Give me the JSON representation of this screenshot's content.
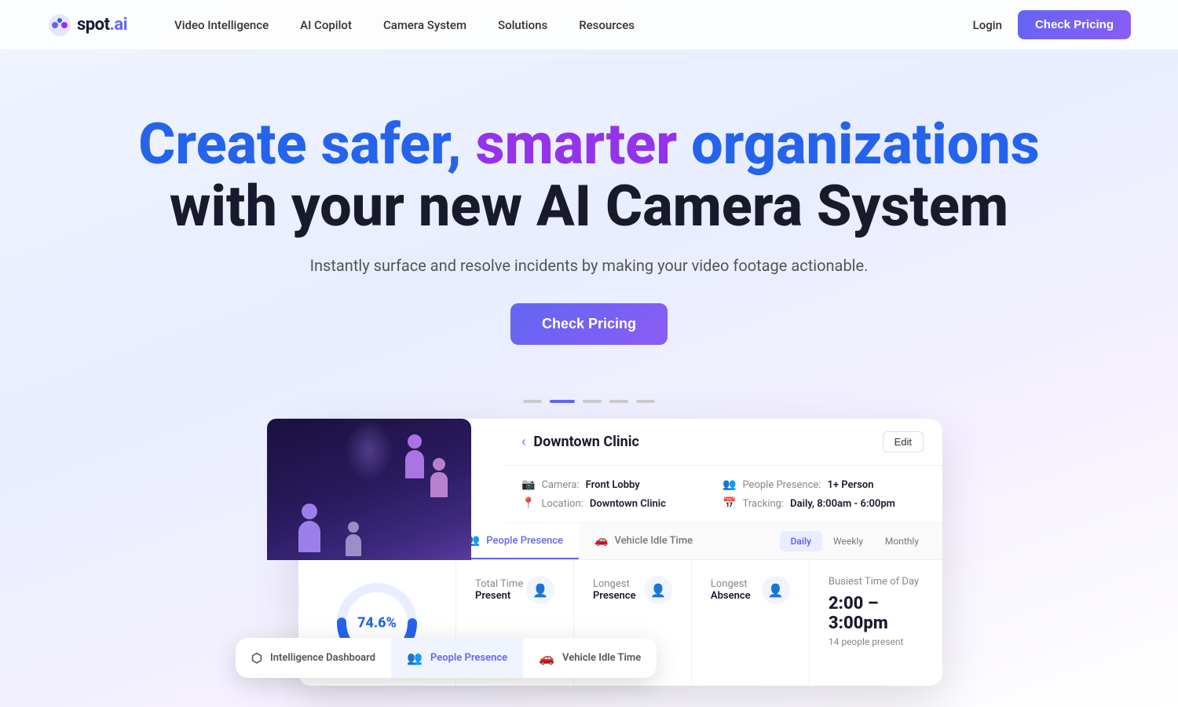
{
  "nav": {
    "logo_text": "spot.ai",
    "links": [
      {
        "label": "Video Intelligence"
      },
      {
        "label": "AI Copilot"
      },
      {
        "label": "Camera System"
      },
      {
        "label": "Solutions"
      },
      {
        "label": "Resources"
      }
    ],
    "login_label": "Login",
    "check_pricing_label": "Check Pricing"
  },
  "hero": {
    "title_line1_part1": "Create safer, ",
    "title_line1_part2": "smarter ",
    "title_line1_part3": "organizations",
    "title_line2": "with your new AI Camera System",
    "subtitle": "Instantly surface and resolve incidents by making your video footage actionable.",
    "cta_label": "Check Pricing"
  },
  "dots": [
    {
      "active": false
    },
    {
      "active": true
    },
    {
      "active": false
    },
    {
      "active": false
    },
    {
      "active": false
    }
  ],
  "dashboard": {
    "back_label": "‹",
    "title": "Downtown Clinic",
    "edit_label": "Edit",
    "meta": [
      {
        "icon": "📷",
        "label": "Camera:",
        "value": "Front Lobby"
      },
      {
        "icon": "👥",
        "label": "People Presence:",
        "value": "1+ Person"
      },
      {
        "icon": "📍",
        "label": "Location:",
        "value": "Downtown Clinic"
      },
      {
        "icon": "📅",
        "label": "Tracking:",
        "value": "Daily, 8:00am - 6:00pm"
      }
    ],
    "tabs": [
      {
        "label": "Intelligence Dashboard",
        "icon": "⬡",
        "active": false
      },
      {
        "label": "People Presence",
        "icon": "👥",
        "active": true
      },
      {
        "label": "Vehicle Idle Time",
        "icon": "🚗",
        "active": false
      }
    ],
    "period_tabs": [
      {
        "label": "Daily",
        "active": true
      },
      {
        "label": "Weekly",
        "active": false
      },
      {
        "label": "Monthly",
        "active": false
      }
    ],
    "donut_value": "74.6%",
    "stats": [
      {
        "label_part1": "Total Time",
        "label_part2": "Present",
        "value": "",
        "icon": "👤"
      },
      {
        "label_part1": "Longest",
        "label_part2": "Presence",
        "value": "",
        "icon": "👤"
      },
      {
        "label_part1": "Longest",
        "label_part2": "Absence",
        "value": "",
        "icon": "👤"
      }
    ],
    "busiest": {
      "title": "Busiest Time of Day",
      "time": "2:00 – 3:00pm",
      "sub": "14 people present"
    }
  },
  "float_tabs": [
    {
      "label": "Intelligence Dashboard",
      "icon": "⬡",
      "active": false
    },
    {
      "label": "People Presence",
      "icon": "👥",
      "active": true
    },
    {
      "label": "Vehicle Idle Time",
      "icon": "🚗",
      "active": false
    }
  ],
  "colors": {
    "blue": "#2563eb",
    "purple": "#9333ea",
    "indigo": "#6366f1",
    "dark": "#1a1a2e"
  }
}
